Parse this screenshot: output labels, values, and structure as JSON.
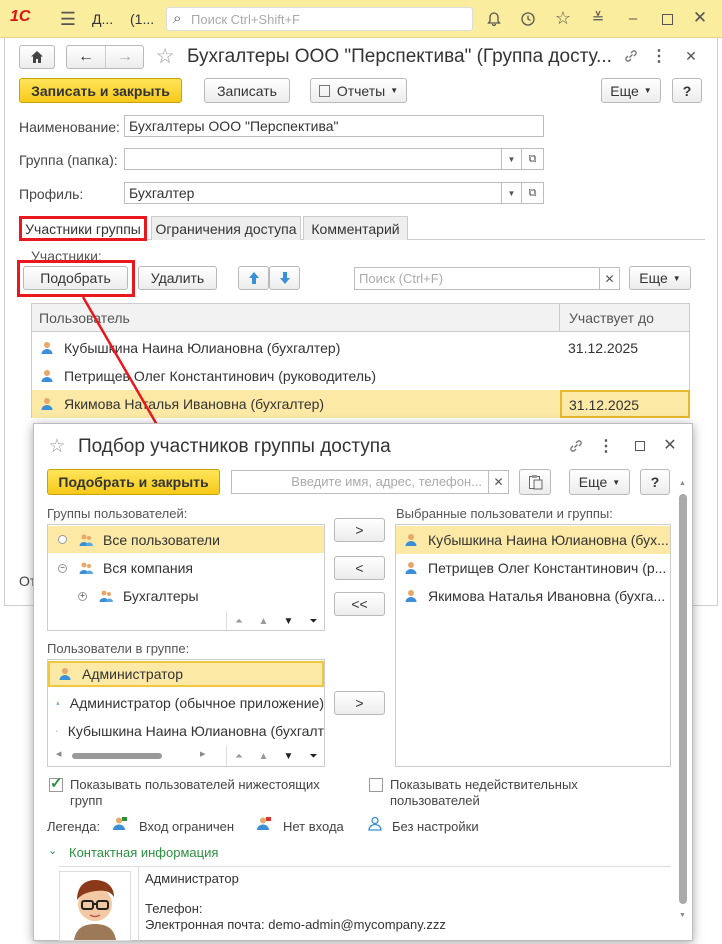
{
  "topbar": {
    "app_logo": "1С",
    "tab_text": "Д...",
    "tab_count": "(1...",
    "search_placeholder": "Поиск Ctrl+Shift+F"
  },
  "main": {
    "title": "Бухгалтеры ООО \"Перспектива\" (Группа досту...",
    "save_close_label": "Записать и закрыть",
    "save_label": "Записать",
    "reports_label": "Отчеты",
    "more_label": "Еще",
    "help_label": "?",
    "name_label": "Наименование:",
    "name_value": "Бухгалтеры ООО \"Перспектива\"",
    "group_label": "Группа (папка):",
    "group_value": "",
    "profile_label": "Профиль:",
    "profile_value": "Бухгалтер",
    "tabs": [
      "Участники группы",
      "Ограничения доступа",
      "Комментарий"
    ],
    "members_label": "Участники:",
    "pick_label": "Подобрать",
    "delete_label": "Удалить",
    "search_placeholder": "Поиск (Ctrl+F)",
    "table_more_label": "Еще",
    "col_user": "Пользователь",
    "col_until": "Участвует до",
    "rows": [
      {
        "user": "Кубышкина Наина Юлиановна (бухгалтер)",
        "until": "31.12.2025"
      },
      {
        "user": "Петрищев Олег Константинович (руководитель)",
        "until": ""
      },
      {
        "user": "Якимова Наталья Ивановна (бухгалтер)",
        "until": "31.12.2025"
      }
    ],
    "bottom_cut": "От"
  },
  "dialog": {
    "title": "Подбор участников группы доступа",
    "pick_close_label": "Подобрать и закрыть",
    "search_placeholder": "Введите имя, адрес, телефон...",
    "more_label": "Еще",
    "help_label": "?",
    "groups_label": "Группы пользователей:",
    "groups": [
      "Все пользователи",
      "Вся компания",
      "Бухгалтеры"
    ],
    "selected_label": "Выбранные пользователи и группы:",
    "selected": [
      "Кубышкина Наина Юлиановна (бух...",
      "Петрищев Олег Константинович (р...",
      "Якимова Наталья Ивановна (бухга..."
    ],
    "move_right": ">",
    "move_left": "<",
    "move_all_left": "<<",
    "users_label": "Пользователи в группе:",
    "users": [
      "Администратор",
      "Администратор (обычное приложение)",
      "Кубышкина Наина Юлиановна (бухгалт"
    ],
    "show_sub_label": "Показывать пользователей нижестоящих групп",
    "show_sub_checked": true,
    "show_invalid_label": "Показывать недействительных пользователей",
    "show_invalid_checked": false,
    "legend_label": "Легенда:",
    "legend_restricted": "Вход ограничен",
    "legend_noentry": "Нет входа",
    "legend_nosetup": "Без настройки",
    "contact_label": "Контактная информация",
    "contact_name": "Администратор",
    "contact_phone": "Телефон:",
    "contact_email": "Электронная почта: demo-admin@mycompany.zzz"
  },
  "colors": {
    "accent_red": "#e8181e",
    "yellow_btn": "#f6c919",
    "selection": "#fbe9a5",
    "link_green": "#2b9040",
    "icon_blue": "#3a8fd6"
  }
}
